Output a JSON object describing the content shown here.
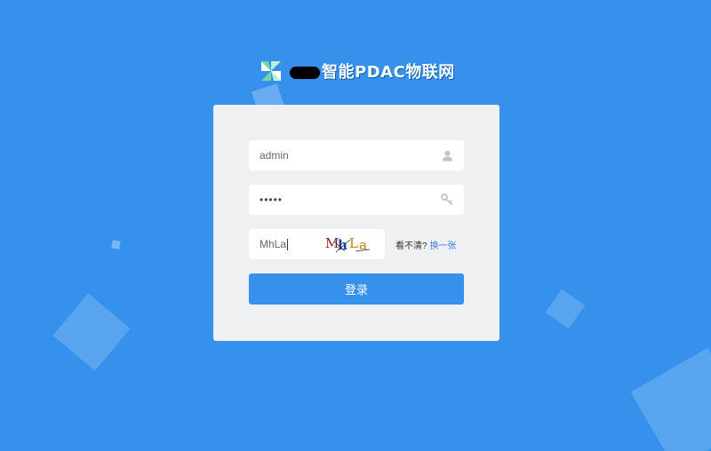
{
  "brand": {
    "title_suffix": "智能PDAC物联网",
    "logo_icon": "pinwheel-logo-icon"
  },
  "login": {
    "username_value": "admin",
    "password_value": "•••••",
    "captcha_value": "MhLa",
    "captcha_image_text": "MhLa",
    "unclear_label": "看不清?",
    "change_link": "换一张",
    "submit_label": "登录"
  },
  "icons": {
    "username": "user-icon",
    "password": "key-icon"
  },
  "colors": {
    "background": "#3591ec",
    "panel": "#eef0f2",
    "button": "#3591ec",
    "link": "#3b7de0"
  }
}
